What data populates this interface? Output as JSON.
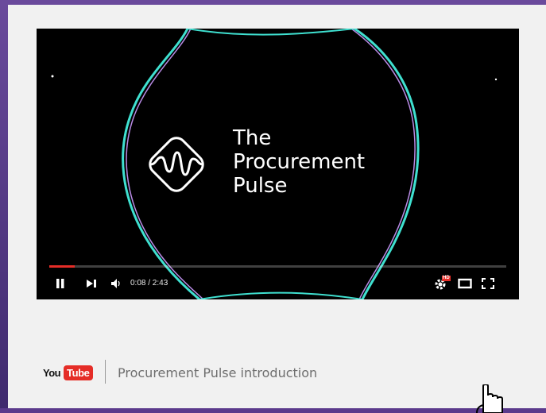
{
  "player": {
    "title_lines": [
      "The",
      "Procurement",
      "Pulse"
    ],
    "time_display": "0:08 / 2:43",
    "progress_fraction": 0.055,
    "hd_badge": "HD",
    "accent_color": "#e52d27",
    "icons": [
      "pause-icon",
      "next-icon",
      "volume-icon",
      "settings-icon",
      "theater-mode-icon",
      "fullscreen-icon"
    ]
  },
  "caption": {
    "logo_you": "You",
    "logo_tube": "Tube",
    "text": "Procurement Pulse introduction"
  }
}
